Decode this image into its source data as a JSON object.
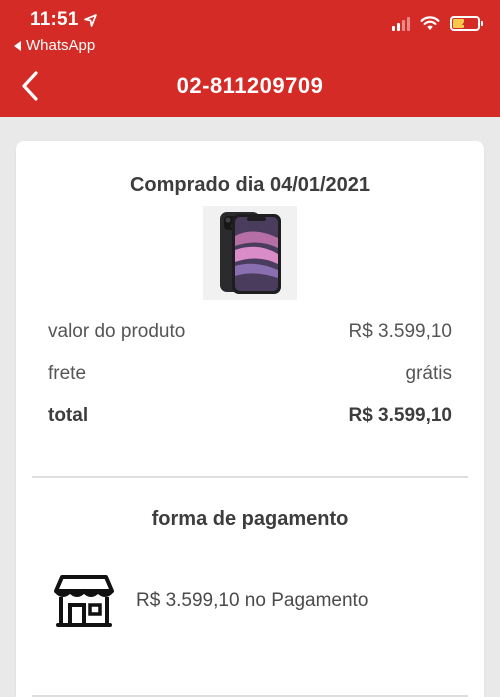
{
  "status_bar": {
    "time": "11:51",
    "back_app": "WhatsApp"
  },
  "header": {
    "title": "02-811209709",
    "accent_color": "#d52b26"
  },
  "order": {
    "purchase_date": "Comprado dia 04/01/2021",
    "product_image": "iphone-11-black",
    "rows": [
      {
        "label": "valor do produto",
        "value": "R$ 3.599,10"
      },
      {
        "label": "frete",
        "value": "grátis"
      },
      {
        "label": "total",
        "value": "R$ 3.599,10"
      }
    ]
  },
  "payment": {
    "heading": "forma de pagamento",
    "icon": "store-icon",
    "text": "R$ 3.599,10 no Pagamento"
  }
}
